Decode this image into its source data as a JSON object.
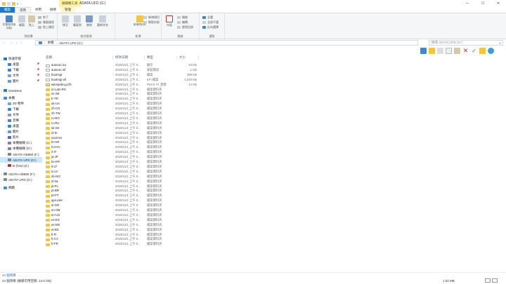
{
  "window": {
    "context_tab": "磁碟機工具",
    "title": "ADATA UFD (G:)",
    "minimize": "—",
    "maximize": "☐",
    "close": "✕"
  },
  "ribbon_tabs": [
    "檔案",
    "常用",
    "共用",
    "檢視",
    "管理"
  ],
  "ribbon": {
    "clipboard": {
      "pin_label": "釘選到[快速存取]",
      "copy": "複製",
      "paste": "貼上",
      "cut": "剪下",
      "copy_path": "複製路徑",
      "paste_shortcut": "貼上捷徑",
      "group": "剪貼簿"
    },
    "organize": {
      "move_to": "移至",
      "copy_to": "複製到",
      "delete": "刪除",
      "rename": "重新命名",
      "group": "組合管理"
    },
    "new": {
      "new_folder": "新增資料夾",
      "new_item": "新增項目",
      "easy_access": "輕鬆存取",
      "group": "新增"
    },
    "open": {
      "properties": "內容",
      "open": "開啟",
      "edit": "編輯",
      "history": "歷程記錄",
      "group": "開啟"
    },
    "select": {
      "select_all": "全選",
      "select_none": "全部不選",
      "invert": "反向選擇",
      "group": "選取"
    }
  },
  "address": {
    "back": "←",
    "forward": "→",
    "up": "↑",
    "crumbs": [
      "本機",
      "ADATA UFD (G:)"
    ],
    "search_placeholder": "搜尋 ADATA UFD (G:)"
  },
  "nav": [
    {
      "label": "快速存取",
      "icon": "star-icon",
      "color": "#1e7bd6",
      "indent": 0,
      "chev": "⌄",
      "pin": false
    },
    {
      "label": "桌面",
      "icon": "desktop-icon",
      "color": "#2b8ad8",
      "indent": 1,
      "chev": "",
      "pin": true
    },
    {
      "label": "下載",
      "icon": "download-icon",
      "color": "#2b8ad8",
      "indent": 1,
      "chev": "",
      "pin": true
    },
    {
      "label": "文件",
      "icon": "document-icon",
      "color": "#8aa0b8",
      "indent": 1,
      "chev": "",
      "pin": true
    },
    {
      "label": "圖片",
      "icon": "picture-icon",
      "color": "#5aa0d8",
      "indent": 1,
      "chev": "",
      "pin": true
    },
    {
      "label": "OneDrive",
      "icon": "cloud-icon",
      "color": "#1e7bd6",
      "indent": 0,
      "chev": "›",
      "pin": false
    },
    {
      "label": "本機",
      "icon": "computer-icon",
      "color": "#3a8fd6",
      "indent": 0,
      "chev": "⌄",
      "pin": false
    },
    {
      "label": "3D 物件",
      "icon": "cube-icon",
      "color": "#6fa8dc",
      "indent": 1,
      "chev": "›",
      "pin": false
    },
    {
      "label": "下載",
      "icon": "download-icon",
      "color": "#2b8ad8",
      "indent": 1,
      "chev": "›",
      "pin": false
    },
    {
      "label": "文件",
      "icon": "document-icon",
      "color": "#8aa0b8",
      "indent": 1,
      "chev": "›",
      "pin": false
    },
    {
      "label": "音樂",
      "icon": "music-icon",
      "color": "#4a86c5",
      "indent": 1,
      "chev": "›",
      "pin": false
    },
    {
      "label": "桌面",
      "icon": "desktop-icon",
      "color": "#2b8ad8",
      "indent": 1,
      "chev": "›",
      "pin": false
    },
    {
      "label": "圖片",
      "icon": "picture-icon",
      "color": "#5aa0d8",
      "indent": 1,
      "chev": "›",
      "pin": false
    },
    {
      "label": "影片",
      "icon": "video-icon",
      "color": "#6a5acd",
      "indent": 1,
      "chev": "›",
      "pin": false
    },
    {
      "label": "本機磁碟 (C:)",
      "icon": "drive-icon",
      "color": "#7a8a9a",
      "indent": 1,
      "chev": "›",
      "pin": false
    },
    {
      "label": "本機磁碟 (D:)",
      "icon": "drive-icon",
      "color": "#7a8a9a",
      "indent": 1,
      "chev": "›",
      "pin": false
    },
    {
      "label": "ADATA HD650 (F:)",
      "icon": "drive-icon",
      "color": "#7a8a9a",
      "indent": 1,
      "chev": "›",
      "pin": false
    },
    {
      "label": "ADATA UFD (G:)",
      "icon": "usb-drive-icon",
      "color": "#7a8a9a",
      "indent": 1,
      "chev": "›",
      "pin": false,
      "selected": true
    },
    {
      "label": "D (\\\\ns) (Z:)",
      "icon": "network-drive-icon",
      "color": "#c0392b",
      "indent": 1,
      "chev": "›",
      "pin": false
    },
    {
      "label": "ADATA HD650 (F:)",
      "icon": "drive-icon",
      "color": "#7a8a9a",
      "indent": 0,
      "chev": "›",
      "pin": false
    },
    {
      "label": "ADATA UFD (G:)",
      "icon": "usb-drive-icon",
      "color": "#7a8a9a",
      "indent": 0,
      "chev": "›",
      "pin": false
    },
    {
      "label": "網路",
      "icon": "network-icon",
      "color": "#3a8fd6",
      "indent": 0,
      "chev": "›",
      "pin": false
    }
  ],
  "columns": {
    "name": "名稱",
    "date": "修改日期",
    "type": "類型",
    "size": "大小"
  },
  "files": [
    {
      "name": "autorun.ico",
      "date": "2019/11/1 上午 0...",
      "type": "圖示",
      "size": "34 KB",
      "kind": "file"
    },
    {
      "name": "autorun.inf",
      "date": "2019/11/1 上午 0...",
      "type": "安裝資訊",
      "size": "1 KB",
      "kind": "file"
    },
    {
      "name": "bootmgr",
      "date": "2019/11/1 上午 0...",
      "type": "檔案",
      "size": "399 KB",
      "kind": "file"
    },
    {
      "name": "bootmgr.efi",
      "date": "2019/11/1 上午 0...",
      "type": "EFI 檔案",
      "size": "1,220 KB",
      "kind": "file"
    },
    {
      "name": "winsipolicy.p7b",
      "date": "2019/11/1 上午 0...",
      "type": "PKCS #7 憑證",
      "size": "14 KB",
      "kind": "cert"
    },
    {
      "name": "sr-Latn-RS",
      "date": "2019/11/1 上午 0...",
      "type": "檔案資料夾",
      "size": "",
      "kind": "folder"
    },
    {
      "name": "sv-SE",
      "date": "2019/11/1 上午 0...",
      "type": "檔案資料夾",
      "size": "",
      "kind": "folder"
    },
    {
      "name": "tr-TR",
      "date": "2019/11/1 上午 0...",
      "type": "檔案資料夾",
      "size": "",
      "kind": "folder"
    },
    {
      "name": "uk-UA",
      "date": "2019/11/1 上午 0...",
      "type": "檔案資料夾",
      "size": "",
      "kind": "folder"
    },
    {
      "name": "zh-CN",
      "date": "2019/11/1 上午 0...",
      "type": "檔案資料夾",
      "size": "",
      "kind": "folder"
    },
    {
      "name": "zh-TW",
      "date": "2019/11/1 上午 0...",
      "type": "檔案資料夾",
      "size": "",
      "kind": "folder"
    },
    {
      "name": "ro-RO",
      "date": "2019/11/1 上午 0...",
      "type": "檔案資料夾",
      "size": "",
      "kind": "folder"
    },
    {
      "name": "ru-RU",
      "date": "2019/11/1 上午 0...",
      "type": "檔案資料夾",
      "size": "",
      "kind": "folder"
    },
    {
      "name": "sk-SK",
      "date": "2019/11/1 上午 0...",
      "type": "檔案資料夾",
      "size": "",
      "kind": "folder"
    },
    {
      "name": "sl-SI",
      "date": "2019/11/1 上午 0...",
      "type": "檔案資料夾",
      "size": "",
      "kind": "folder"
    },
    {
      "name": "sources",
      "date": "2019/11/1 上午 0...",
      "type": "檔案資料夾",
      "size": "",
      "kind": "folder"
    },
    {
      "name": "hr-HR",
      "date": "2019/11/1 上午 0...",
      "type": "檔案資料夾",
      "size": "",
      "kind": "folder"
    },
    {
      "name": "hu-HU",
      "date": "2019/11/1 上午 0...",
      "type": "檔案資料夾",
      "size": "",
      "kind": "folder"
    },
    {
      "name": "it-IT",
      "date": "2019/11/1 上午 0...",
      "type": "檔案資料夾",
      "size": "",
      "kind": "folder"
    },
    {
      "name": "ja-JP",
      "date": "2019/11/1 上午 0...",
      "type": "檔案資料夾",
      "size": "",
      "kind": "folder"
    },
    {
      "name": "ko-KR",
      "date": "2019/11/1 上午 0...",
      "type": "檔案資料夾",
      "size": "",
      "kind": "folder"
    },
    {
      "name": "lt-LT",
      "date": "2019/11/1 上午 0...",
      "type": "檔案資料夾",
      "size": "",
      "kind": "folder"
    },
    {
      "name": "lv-LV",
      "date": "2019/11/1 上午 0...",
      "type": "檔案資料夾",
      "size": "",
      "kind": "folder"
    },
    {
      "name": "nb-NO",
      "date": "2019/11/1 上午 0...",
      "type": "檔案資料夾",
      "size": "",
      "kind": "folder"
    },
    {
      "name": "nl-NL",
      "date": "2019/11/1 上午 0...",
      "type": "檔案資料夾",
      "size": "",
      "kind": "folder"
    },
    {
      "name": "pl-PL",
      "date": "2019/11/1 上午 0...",
      "type": "檔案資料夾",
      "size": "",
      "kind": "folder"
    },
    {
      "name": "pt-BR",
      "date": "2019/11/1 上午 0...",
      "type": "檔案資料夾",
      "size": "",
      "kind": "folder"
    },
    {
      "name": "pt-PT",
      "date": "2019/11/1 上午 0...",
      "type": "檔案資料夾",
      "size": "",
      "kind": "folder"
    },
    {
      "name": "qps-ploc",
      "date": "2019/11/1 上午 0...",
      "type": "檔案資料夾",
      "size": "",
      "kind": "folder"
    },
    {
      "name": "el-GR",
      "date": "2019/11/1 上午 0...",
      "type": "檔案資料夾",
      "size": "",
      "kind": "folder"
    },
    {
      "name": "en-GB",
      "date": "2019/11/1 上午 0...",
      "type": "檔案資料夾",
      "size": "",
      "kind": "folder"
    },
    {
      "name": "en-US",
      "date": "2019/11/1 上午 0...",
      "type": "檔案資料夾",
      "size": "",
      "kind": "folder"
    },
    {
      "name": "es-ES",
      "date": "2019/11/1 上午 0...",
      "type": "檔案資料夾",
      "size": "",
      "kind": "folder"
    },
    {
      "name": "es-MX",
      "date": "2019/11/1 上午 0...",
      "type": "檔案資料夾",
      "size": "",
      "kind": "folder"
    },
    {
      "name": "et-EE",
      "date": "2019/11/1 上午 0...",
      "type": "檔案資料夾",
      "size": "",
      "kind": "folder"
    },
    {
      "name": "fi-FI",
      "date": "2019/11/1 上午 0...",
      "type": "檔案資料夾",
      "size": "",
      "kind": "folder"
    },
    {
      "name": "fr-CA",
      "date": "2019/11/1 上午 0...",
      "type": "檔案資料夾",
      "size": "",
      "kind": "folder"
    },
    {
      "name": "fr-FR",
      "date": "2019/11/1 上午 0...",
      "type": "檔案資料夾",
      "size": "",
      "kind": "folder"
    }
  ],
  "status": {
    "item_count": "44 個項目",
    "selection": "44 個項目 (磁碟可用空間: 13.0 GB)",
    "total_size": "1.62 MB"
  },
  "colors": {
    "accent": "#1979ca",
    "selected": "#cce8ff",
    "folder": "#f5c542",
    "context_tab": "#fff2a8"
  }
}
